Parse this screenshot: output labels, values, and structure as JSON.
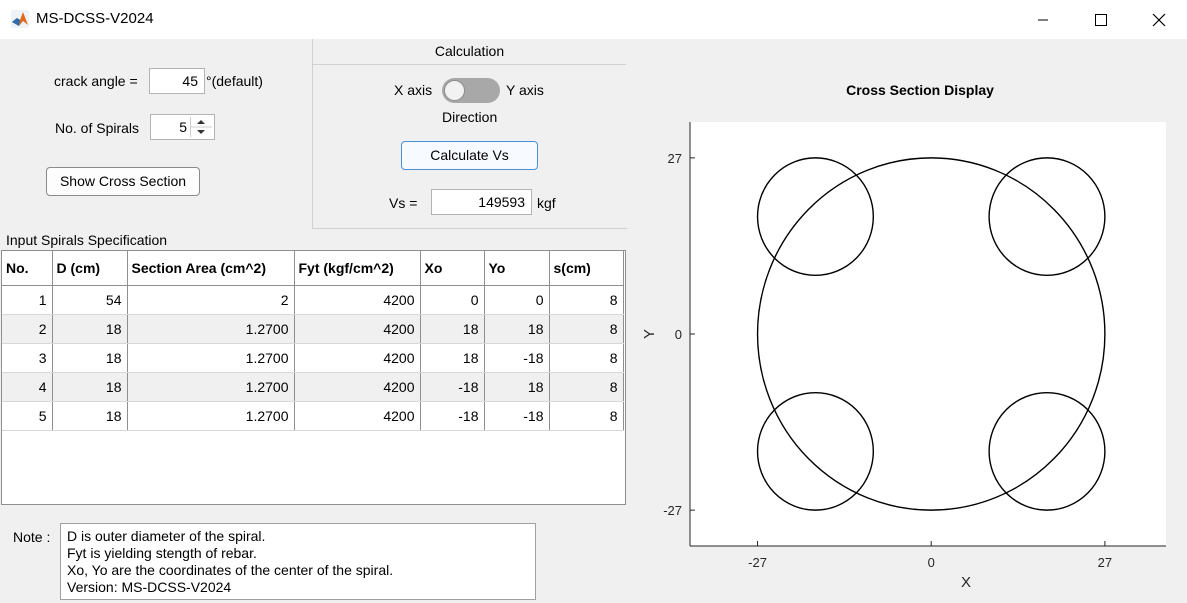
{
  "window": {
    "title": "MS-DCSS-V2024",
    "app_icon": "matlab-icon",
    "controls": [
      "minimize-icon",
      "maximize-icon",
      "close-icon"
    ]
  },
  "inputs": {
    "crack_angle_label": "crack angle =",
    "crack_angle_value": "45",
    "crack_angle_unit": "°(default)",
    "spirals_label": "No. of Spirals",
    "spirals_value": "5",
    "show_button": "Show Cross Section"
  },
  "calculation": {
    "title": "Calculation",
    "x_axis_label": "X axis",
    "y_axis_label": "Y axis",
    "direction_label": "Direction",
    "toggle_state": "X axis",
    "calc_button": "Calculate Vs",
    "vs_label": "Vs =",
    "vs_value": "149593",
    "vs_unit": "kgf"
  },
  "spec_table": {
    "title": "Input Spirals Specification",
    "columns": [
      "No.",
      "D (cm)",
      "Section Area (cm^2)",
      "Fyt (kgf/cm^2)",
      "Xo",
      "Yo",
      "s(cm)"
    ],
    "rows": [
      [
        "1",
        "54",
        "2",
        "4200",
        "0",
        "0",
        "8"
      ],
      [
        "2",
        "18",
        "1.2700",
        "4200",
        "18",
        "18",
        "8"
      ],
      [
        "3",
        "18",
        "1.2700",
        "4200",
        "18",
        "-18",
        "8"
      ],
      [
        "4",
        "18",
        "1.2700",
        "4200",
        "-18",
        "18",
        "8"
      ],
      [
        "5",
        "18",
        "1.2700",
        "4200",
        "-18",
        "-18",
        "8"
      ]
    ]
  },
  "note": {
    "label": "Note :",
    "lines": [
      "D is outer diameter of the spiral.",
      "Fyt is yielding stength of rebar.",
      "Xo, Yo are the coordinates of the center of the spiral.",
      "Version: MS-DCSS-V2024"
    ]
  },
  "chart_data": {
    "type": "scatter",
    "title": "Cross Section Display",
    "xlabel": "X",
    "ylabel": "Y",
    "xticks": [
      "-27",
      "0",
      "27"
    ],
    "yticks": [
      "27",
      "0",
      "-27"
    ],
    "xlim": [
      -37.5,
      36.5
    ],
    "ylim": [
      -32.5,
      32.5
    ],
    "grid": false,
    "circles": [
      {
        "x": 0,
        "y": 0,
        "diameter": 54
      },
      {
        "x": 18,
        "y": 18,
        "diameter": 18
      },
      {
        "x": 18,
        "y": -18,
        "diameter": 18
      },
      {
        "x": -18,
        "y": 18,
        "diameter": 18
      },
      {
        "x": -18,
        "y": -18,
        "diameter": 18
      }
    ]
  }
}
